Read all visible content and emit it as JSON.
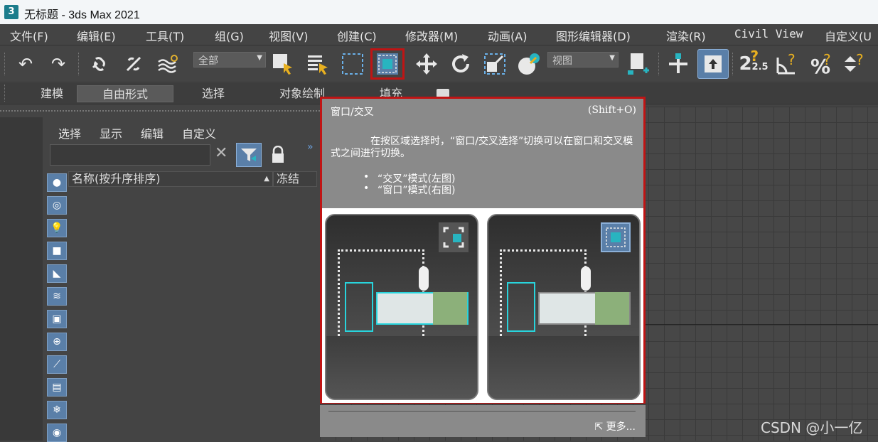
{
  "window": {
    "logo": "3",
    "title": "无标题 - 3ds Max 2021"
  },
  "menubar": {
    "items": [
      "文件(F)",
      "编辑(E)",
      "工具(T)",
      "组(G)",
      "视图(V)",
      "创建(C)",
      "修改器(M)",
      "动画(A)",
      "图形编辑器(D)",
      "渲染(R)",
      "Civil View",
      "自定义(U"
    ]
  },
  "toolbar": {
    "selection_filter": "全部",
    "reference_coord": "视图",
    "snap_label": "2.5"
  },
  "ribbon": {
    "tabs": [
      "建模",
      "自由形式",
      "选择",
      "对象绘制",
      "填充"
    ],
    "active": "自由形式"
  },
  "explorer": {
    "menu": [
      "选择",
      "显示",
      "编辑",
      "自定义"
    ],
    "search_placeholder": "",
    "columns": {
      "name": "名称(按升序排序)",
      "sort_indicator": "▲",
      "frozen": "冻结"
    }
  },
  "tooltip": {
    "title": "窗口/交叉",
    "shortcut": "(Shift+O)",
    "description": "在按区域选择时，“窗口/交叉选择”切换可以在窗口和交叉模式之间进行切换。",
    "bullets": [
      "“交叉”模式(左图)",
      "“窗口”模式(右图)"
    ],
    "more_link": "更多..."
  },
  "watermark": "CSDN @小一亿",
  "colors": {
    "highlight_border": "#c01414",
    "accent_teal": "#28b4c0",
    "active_button": "#5a7fa8"
  }
}
